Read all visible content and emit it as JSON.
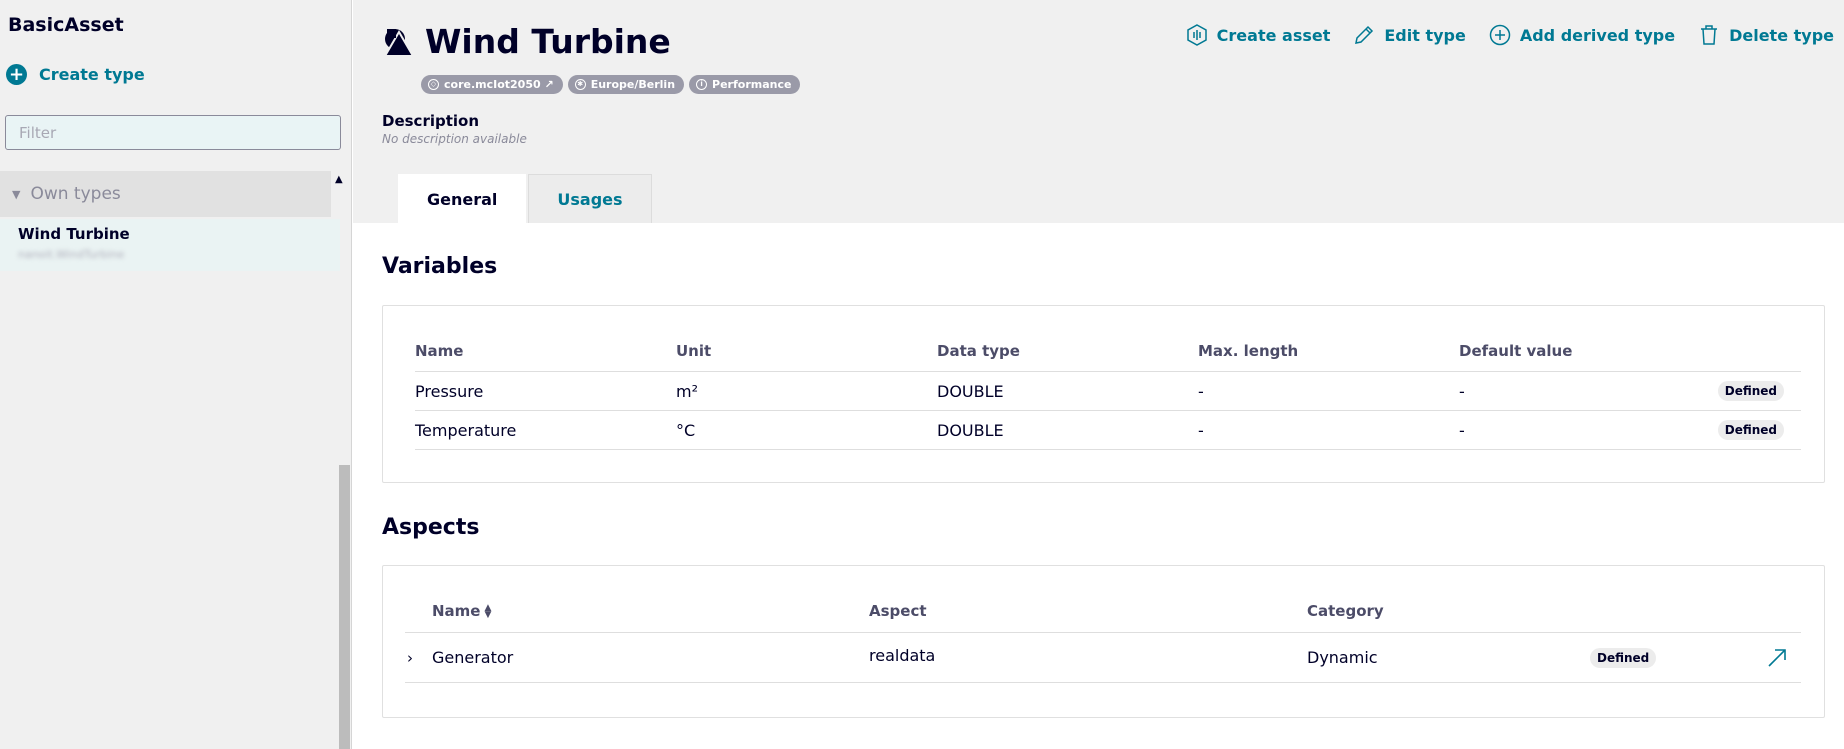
{
  "sidebar": {
    "title": "BasicAsset",
    "create_type_label": "Create type",
    "filter_placeholder": "Filter",
    "group_label": "Own types",
    "item": {
      "name": "Wind Turbine",
      "sub": "nanoit.WindTurbine"
    }
  },
  "header": {
    "title": "Wind Turbine",
    "actions": [
      {
        "label": "Create asset",
        "icon": "create-asset-icon"
      },
      {
        "label": "Edit type",
        "icon": "pencil-icon"
      },
      {
        "label": "Add derived type",
        "icon": "plus-circle-icon"
      },
      {
        "label": "Delete type",
        "icon": "trash-icon"
      }
    ],
    "badges": [
      {
        "label": "core.mcIot2050 ↗",
        "icon": "tenant-icon"
      },
      {
        "label": "Europe/Berlin",
        "icon": "globe-icon"
      },
      {
        "label": "Performance",
        "icon": "info-icon"
      }
    ],
    "description_label": "Description",
    "description_value": "No description available"
  },
  "tabs": [
    {
      "label": "General",
      "active": true
    },
    {
      "label": "Usages",
      "active": false
    }
  ],
  "variables": {
    "title": "Variables",
    "columns": [
      "Name",
      "Unit",
      "Data type",
      "Max. length",
      "Default value"
    ],
    "rows": [
      {
        "name": "Pressure",
        "unit": "m²",
        "data_type": "DOUBLE",
        "max_length": "-",
        "default_value": "-",
        "status": "Defined"
      },
      {
        "name": "Temperature",
        "unit": "°C",
        "data_type": "DOUBLE",
        "max_length": "-",
        "default_value": "-",
        "status": "Defined"
      }
    ]
  },
  "aspects": {
    "title": "Aspects",
    "columns": [
      "Name",
      "Aspect",
      "Category"
    ],
    "rows": [
      {
        "name": "Generator",
        "aspect": "realdata",
        "category": "Dynamic",
        "status": "Defined"
      }
    ]
  },
  "colors": {
    "accent": "#007993",
    "text": "#000028",
    "panel": "#f0f0f0"
  }
}
